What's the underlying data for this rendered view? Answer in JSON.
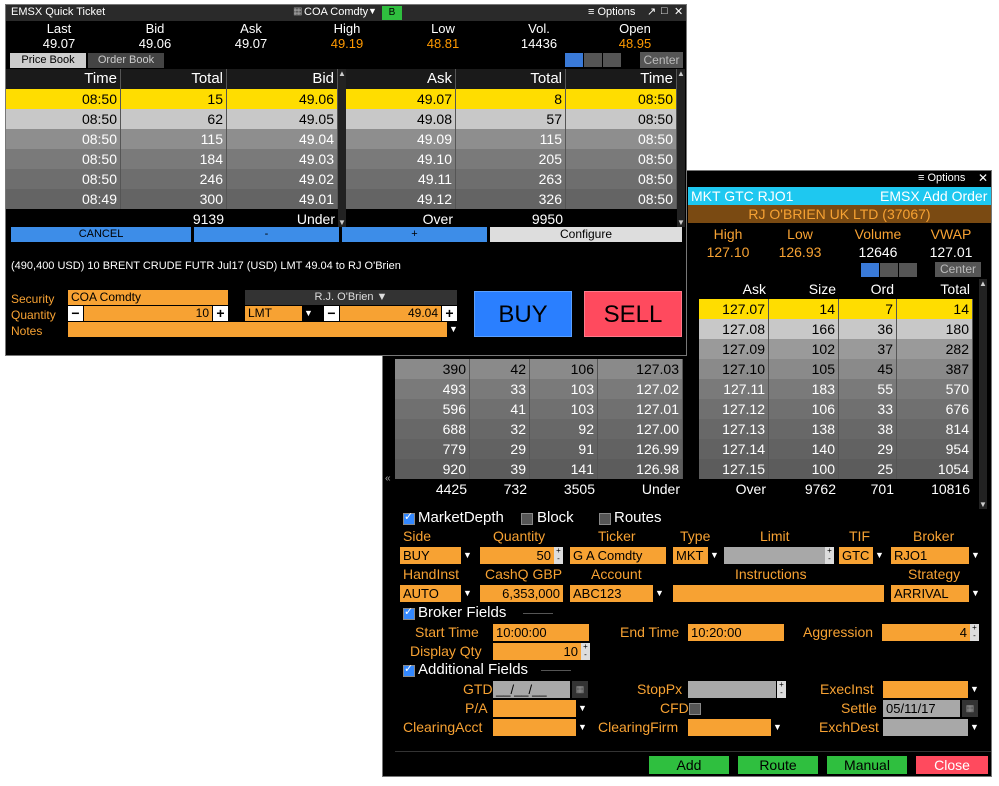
{
  "quick_ticket": {
    "title": "EMSX Quick Ticket",
    "security_selector": "COA Comdty",
    "green_tag": "B",
    "options_label": "Options",
    "stats_headers": [
      "Last",
      "Bid",
      "Ask",
      "High",
      "Low",
      "Vol.",
      "Open"
    ],
    "stats_values": [
      "49.07",
      "49.06",
      "49.07",
      "49.19",
      "48.81",
      "14436",
      "48.95"
    ],
    "tabs": [
      "Price Book",
      "Order Book"
    ],
    "center_label": "Center",
    "bid_headers": [
      "Time",
      "Total",
      "Bid"
    ],
    "ask_headers": [
      "Ask",
      "Total",
      "Time"
    ],
    "bid_rows": [
      [
        "08:50",
        "15",
        "49.06"
      ],
      [
        "08:50",
        "62",
        "49.05"
      ],
      [
        "08:50",
        "115",
        "49.04"
      ],
      [
        "08:50",
        "184",
        "49.03"
      ],
      [
        "08:50",
        "246",
        "49.02"
      ],
      [
        "08:49",
        "300",
        "49.01"
      ]
    ],
    "ask_rows": [
      [
        "49.07",
        "8",
        "08:50"
      ],
      [
        "49.08",
        "57",
        "08:50"
      ],
      [
        "49.09",
        "115",
        "08:50"
      ],
      [
        "49.10",
        "205",
        "08:50"
      ],
      [
        "49.11",
        "263",
        "08:50"
      ],
      [
        "49.12",
        "326",
        "08:50"
      ]
    ],
    "bid_total": "9139",
    "bid_under": "Under",
    "ask_over": "Over",
    "ask_total": "9950",
    "buttons": {
      "cancel": "CANCEL",
      "minus": "-",
      "plus": "+",
      "configure": "Configure"
    },
    "order_summary": "(490,400 USD) 10 BRENT CRUDE FUTR  Jul17 (USD) LMT 49.04 to RJ O'Brien",
    "form": {
      "security_label": "Security",
      "security_value": "COA Comdty",
      "broker_value": "R.J. O'Brien",
      "quantity_label": "Quantity",
      "quantity_value": "10",
      "order_type": "LMT",
      "price_value": "49.04",
      "notes_label": "Notes"
    },
    "buy_label": "BUY",
    "sell_label": "SELL"
  },
  "add_order": {
    "options_label": "Options",
    "title_left": "MKT GTC RJO1",
    "title_right": "EMSX Add Order",
    "broker_name": "RJ O'BRIEN UK LTD (37067)",
    "stats_headers": [
      "High",
      "Low",
      "Volume",
      "VWAP"
    ],
    "stats_values": [
      "127.10",
      "126.93",
      "12646",
      "127.01"
    ],
    "center_label": "Center",
    "ask_headers": [
      "Ask",
      "Size",
      "Ord",
      "Total"
    ],
    "ask_rows": [
      [
        "127.07",
        "14",
        "7",
        "14"
      ],
      [
        "127.08",
        "166",
        "36",
        "180"
      ],
      [
        "127.09",
        "102",
        "37",
        "282"
      ],
      [
        "127.10",
        "105",
        "45",
        "387"
      ],
      [
        "127.11",
        "183",
        "55",
        "570"
      ],
      [
        "127.12",
        "106",
        "33",
        "676"
      ],
      [
        "127.13",
        "138",
        "38",
        "814"
      ],
      [
        "127.14",
        "140",
        "29",
        "954"
      ],
      [
        "127.15",
        "100",
        "25",
        "1054"
      ]
    ],
    "bid_rows": [
      [
        "390",
        "42",
        "106",
        "127.03"
      ],
      [
        "493",
        "33",
        "103",
        "127.02"
      ],
      [
        "596",
        "41",
        "103",
        "127.01"
      ],
      [
        "688",
        "32",
        "92",
        "127.00"
      ],
      [
        "779",
        "29",
        "91",
        "126.99"
      ],
      [
        "920",
        "39",
        "141",
        "126.98"
      ]
    ],
    "bid_footer": [
      "4425",
      "732",
      "3505",
      "Under"
    ],
    "ask_footer": [
      "Over",
      "9762",
      "701",
      "10816"
    ],
    "checks": {
      "market_depth": "MarketDepth",
      "block": "Block",
      "routes": "Routes"
    },
    "row1_labels": [
      "Side",
      "Quantity",
      "Ticker",
      "Type",
      "Limit",
      "TIF",
      "Broker"
    ],
    "side": "BUY",
    "quantity": "50",
    "ticker": "G A Comdty",
    "type": "MKT",
    "tif": "GTC",
    "broker": "RJO1",
    "row2_labels": [
      "HandInst",
      "CashQ GBP",
      "Account",
      "Instructions",
      "Strategy"
    ],
    "handinst": "AUTO",
    "cashq": "6,353,000",
    "account": "ABC123",
    "strategy": "ARRIVAL",
    "broker_fields_label": "Broker Fields",
    "start_time_label": "Start Time",
    "start_time": "10:00:00",
    "end_time_label": "End Time",
    "end_time": "10:20:00",
    "aggression_label": "Aggression",
    "aggression": "4",
    "display_qty_label": "Display Qty",
    "display_qty": "10",
    "additional_fields_label": "Additional Fields",
    "gtd_label": "GTD",
    "gtd_value": "__/__/__",
    "stoppx_label": "StopPx",
    "execinst_label": "ExecInst",
    "pa_label": "P/A",
    "cfd_label": "CFD",
    "settle_label": "Settle",
    "settle_value": "05/11/17",
    "clearing_acct_label": "ClearingAcct",
    "clearing_firm_label": "ClearingFirm",
    "exch_dest_label": "ExchDest",
    "buttons": {
      "add": "Add",
      "route": "Route",
      "manual": "Manual",
      "close": "Close"
    }
  },
  "colors": {
    "highlight_yellow": "#ffdd00",
    "orange_field": "#f7a233",
    "buy_blue": "#2a7fff",
    "sell_red": "#ff4a5e",
    "action_green": "#2fbf3f",
    "cyan_bar": "#1ec8f0"
  }
}
